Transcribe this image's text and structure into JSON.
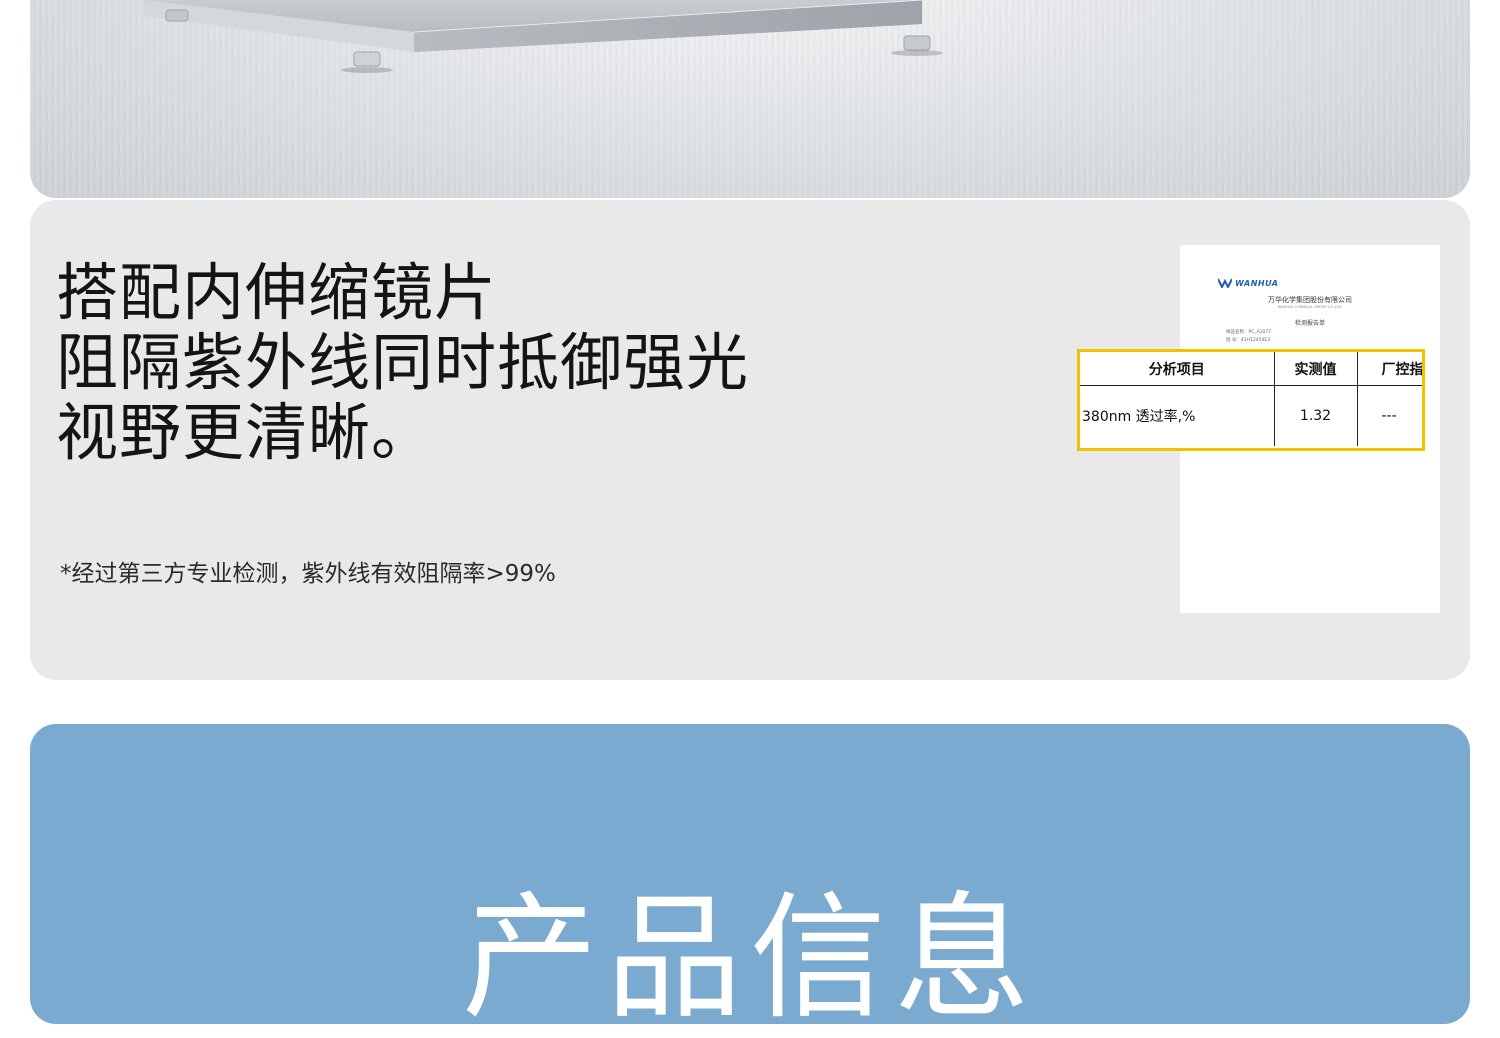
{
  "photo": {
    "subject": "stainless steel cabinet base"
  },
  "info": {
    "headline_lines": [
      "搭配内伸缩镜片",
      "阻隔紫外线同时抵御强光",
      "视野更清晰。"
    ],
    "footnote": "*经过第三方专业检测，紫外线有效阻隔率>99%"
  },
  "report": {
    "logo_text": "WANHUA",
    "company": "万华化学集团股份有限公司",
    "company_en": "WANHUA CHEMICAL GROUP CO.,LTD.",
    "doc_title": "检测报告单",
    "fields": [
      "样品名称：PC_A1077",
      "批  号：41H12454E3"
    ],
    "table": {
      "headers": [
        "分析项目",
        "实测值",
        "厂控指"
      ],
      "row": [
        "380nm 透过率,%",
        "1.32",
        "---"
      ]
    }
  },
  "product": {
    "title": "产品信息"
  },
  "colors": {
    "info_bg": "#e9e9e9",
    "product_bg": "#7aaad0",
    "highlight_border": "#f2c200",
    "logo_blue": "#1f5fa8"
  }
}
